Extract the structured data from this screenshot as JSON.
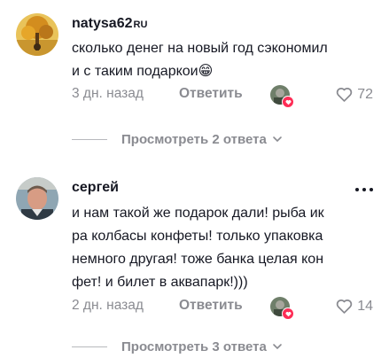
{
  "comments": [
    {
      "username": "natysa62",
      "region": "RU",
      "text_lines": [
        "сколько денег на новый год сэкономил",
        "и с таким подаркои😁"
      ],
      "time": "3 дн. назад",
      "reply_label": "Ответить",
      "likes": "72",
      "view_replies": "Просмотреть 2 ответа"
    },
    {
      "username": "сергей",
      "text_lines": [
        "и нам такой же подарок дали! рыба ик",
        "ра колбасы конфеты! только упаковка",
        "немного другая! тоже банка целая кон",
        "фет! и билет в аквапарк!)))"
      ],
      "time": "2 дн. назад",
      "reply_label": "Ответить",
      "likes": "14",
      "view_replies": "Просмотреть 3 ответа"
    }
  ],
  "icons": {
    "like": "heart-outline-icon",
    "more": "more-horizontal-icon",
    "chevron": "chevron-down-icon",
    "author_heart": "heart-filled-icon"
  },
  "colors": {
    "text": "#161823",
    "muted": "#8a8b91",
    "accent": "#fe2c55"
  }
}
